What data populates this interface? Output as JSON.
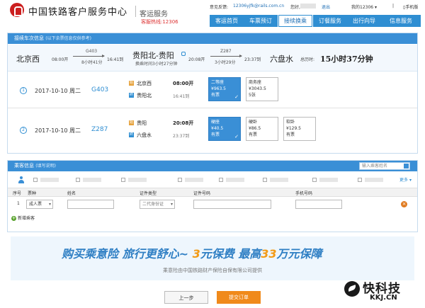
{
  "header": {
    "brand": "中国铁路客户服务中心",
    "service": "客运服务",
    "hotline": "客服热线:12306",
    "toplinks": {
      "feedback": "意见反馈:",
      "feedback_email": "12306yjfk@rails.com.cn",
      "greeting": "您好,",
      "logout": "退出",
      "my12306": "我的12306",
      "mobile": "手机版"
    },
    "nav": [
      "客运首页",
      "车票预订",
      "接续换乘",
      "订餐服务",
      "出行向导",
      "信息服务"
    ],
    "nav_active": 2
  },
  "transfer": {
    "title": "接续车次信息",
    "note": "(以下余票信息仅供参考)",
    "from": "北京西",
    "dep": "08:00开",
    "train1": "G403",
    "dur1": "8小时41分",
    "arr1": "16:41到",
    "mid": "贵阳北-贵阳",
    "mid_wait": "换乘时间3小时27分钟",
    "dep2": "20:08开",
    "train2": "Z287",
    "dur2": "3小时29分",
    "arr2": "23:37到",
    "to": "六盘水",
    "total_label": "总历时:",
    "total": "15小时37分钟"
  },
  "segments": [
    {
      "no": "1",
      "date": "2017-10-10 周二",
      "train": "G403",
      "st_from": "北京西",
      "st_to": "贵阳北",
      "t_dep": "08:00开",
      "t_arr": "16:41到",
      "seats": [
        {
          "name": "二等座",
          "price": "¥963.5",
          "left": "有票"
        },
        {
          "name": "商务座",
          "price": "¥3043.5",
          "left": "5张"
        }
      ]
    },
    {
      "no": "2",
      "date": "2017-10-10 周二",
      "train": "Z287",
      "st_from": "贵阳",
      "st_to": "六盘水",
      "t_dep": "20:08开",
      "t_arr": "23:37到",
      "seats": [
        {
          "name": "硬座",
          "price": "¥40.5",
          "left": "有票"
        },
        {
          "name": "硬卧",
          "price": "¥86.5",
          "left": "有票"
        },
        {
          "name": "软卧",
          "price": "¥129.5",
          "left": "有票"
        }
      ]
    }
  ],
  "passenger": {
    "title": "乘客信息",
    "help": "(填写说明)",
    "search_placeholder": "输入乘客姓名",
    "more": "更多",
    "columns": [
      "序号",
      "票种",
      "姓名",
      "证件类型",
      "证件号码",
      "手机号码"
    ],
    "row": {
      "no": "1",
      "ticket_type": "成人票",
      "name": "",
      "id_type": "二代身份证",
      "id_no": "",
      "phone": ""
    },
    "add": "新增乘客"
  },
  "insurance": {
    "title_a": "购买乘意险  旅行更舒心~",
    "title_b": "3",
    "title_c": "元保费  最高",
    "title_d": "33",
    "title_e": "万元保障",
    "sub": "乘意险由中国铁路财产保险自保有限公司提供"
  },
  "buttons": {
    "prev": "上一步",
    "submit": "提交订单"
  },
  "watermark": {
    "title": "快科技",
    "sub": "KKJ.CN"
  }
}
